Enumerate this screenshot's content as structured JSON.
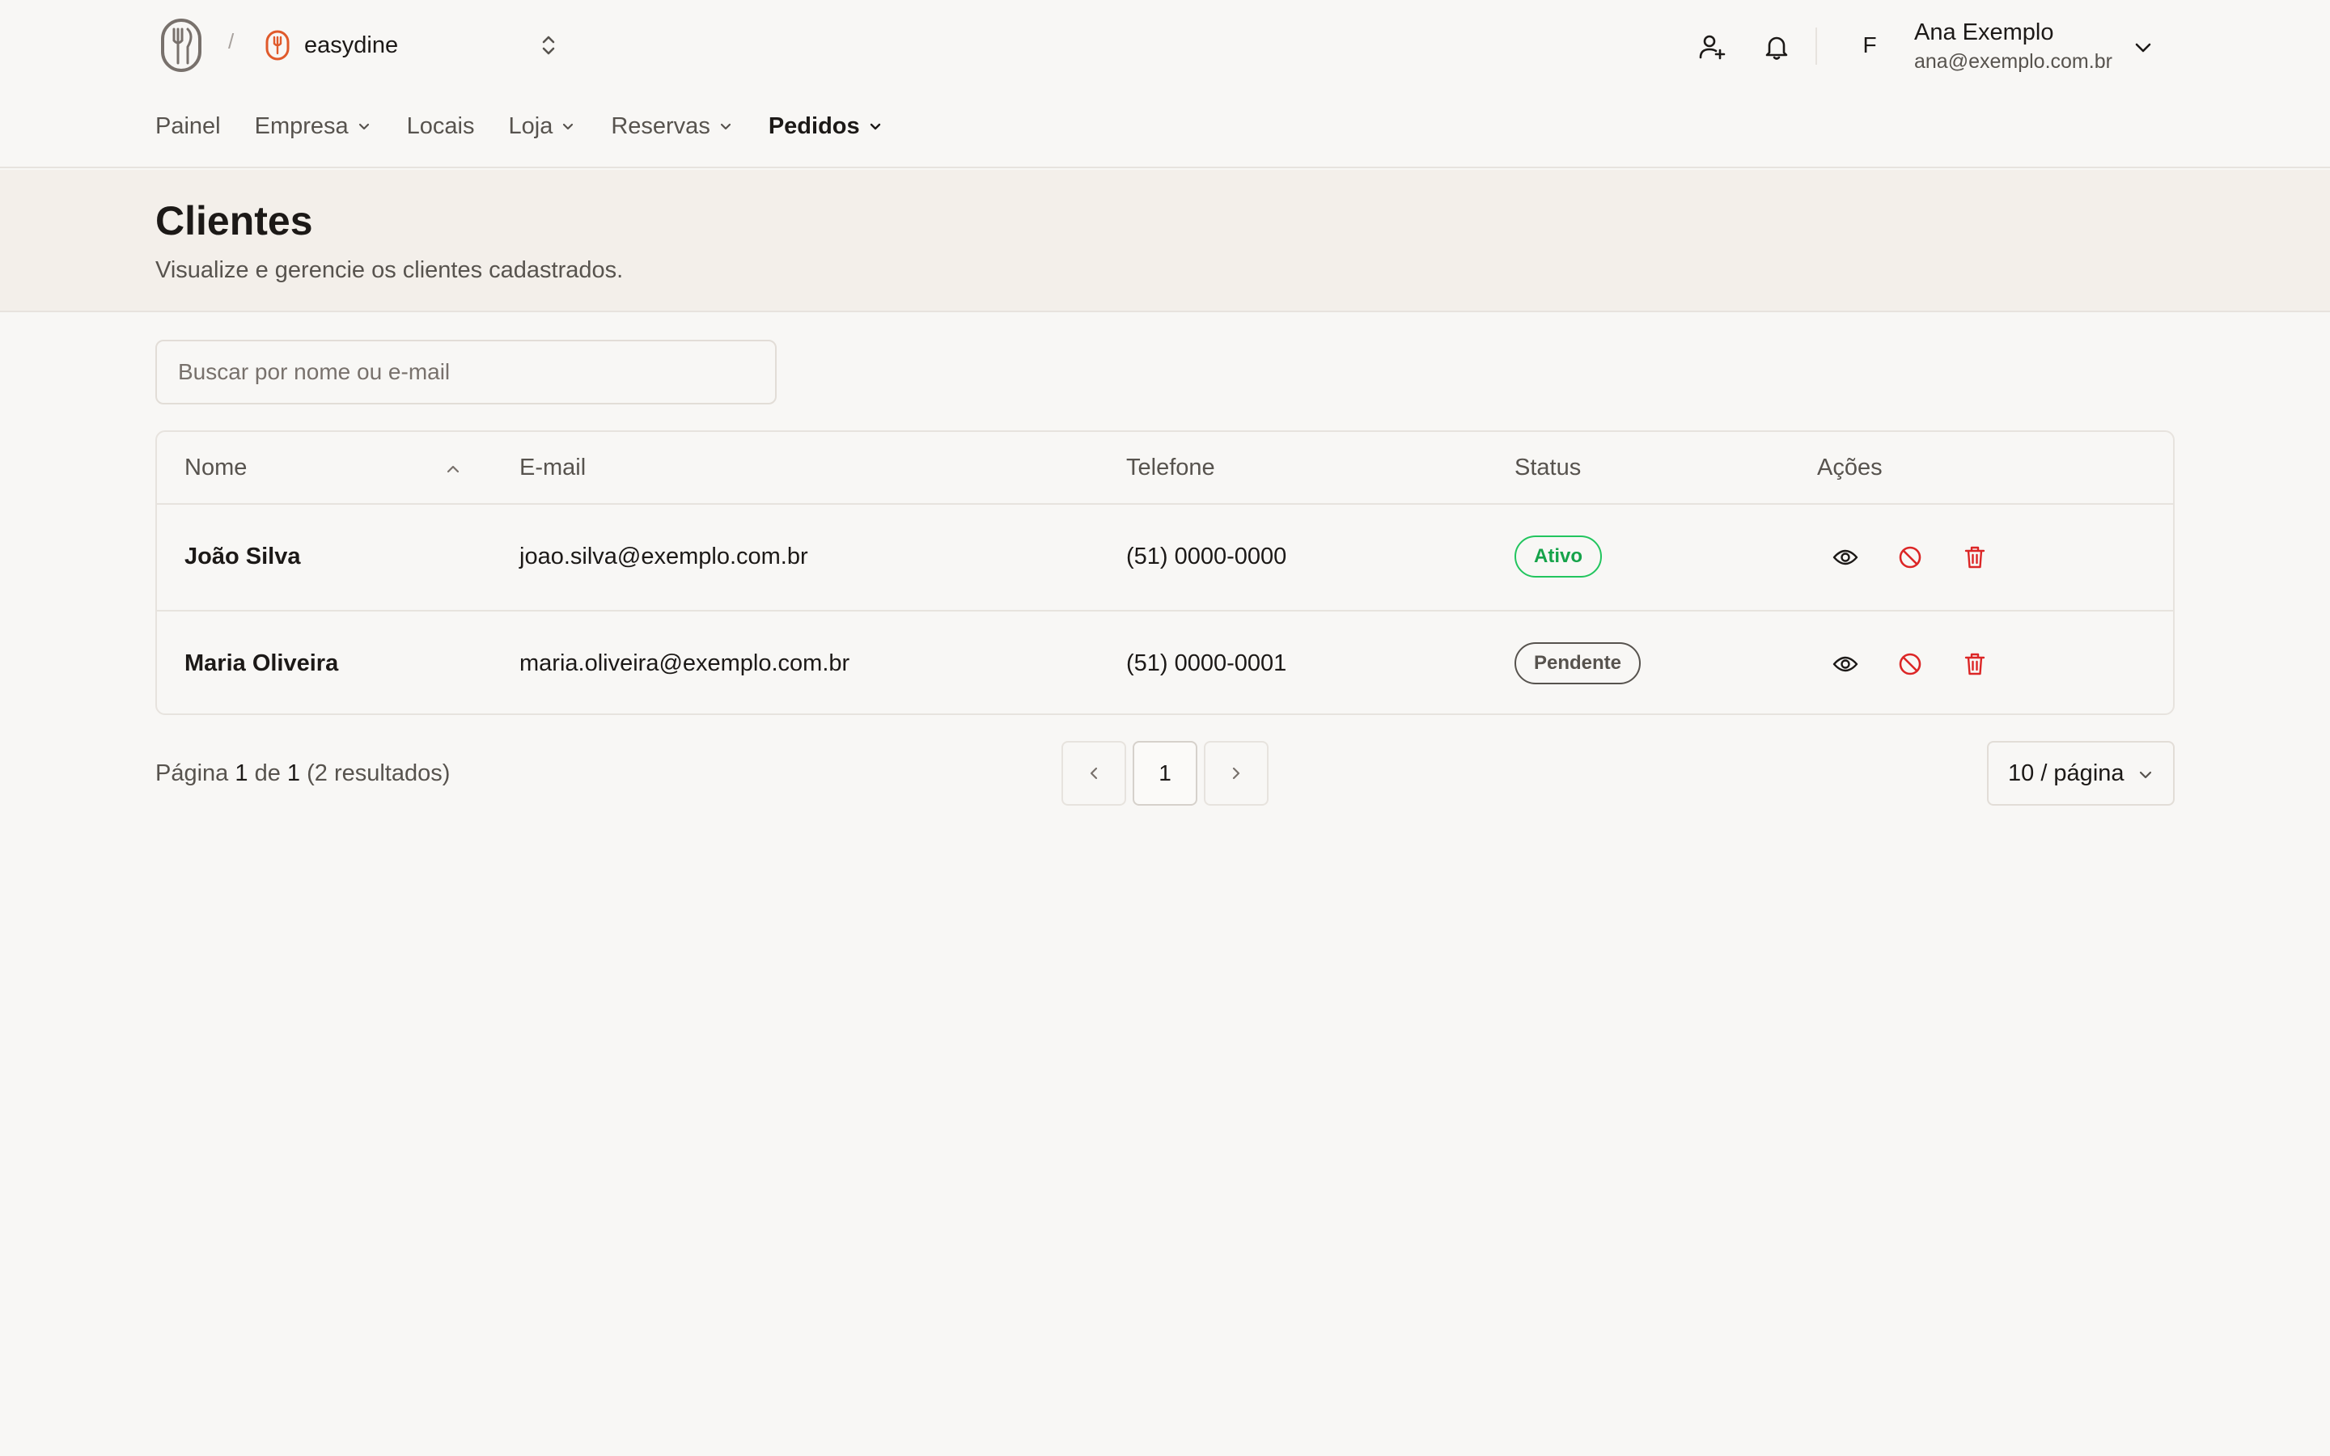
{
  "app": {
    "org_name": "easydine",
    "separator": "/",
    "colors": {
      "accent": "#e05a2b",
      "active_badge": "#16a34a",
      "danger": "#dc2626"
    }
  },
  "header": {
    "icons": [
      "fork-knife-logo-icon",
      "add-user-icon",
      "bell-icon",
      "chevron-down-icon"
    ],
    "user": {
      "initial": "F",
      "name": "Ana Exemplo",
      "email": "ana@exemplo.com.br"
    }
  },
  "nav": {
    "items": [
      {
        "label": "Painel"
      },
      {
        "label": "Empresa"
      },
      {
        "label": "Locais"
      },
      {
        "label": "Loja"
      },
      {
        "label": "Reservas"
      },
      {
        "label": "Pedidos"
      }
    ]
  },
  "page": {
    "title": "Clientes",
    "subtitle": "Visualize e gerencie os clientes cadastrados."
  },
  "search": {
    "placeholder": "Buscar por nome ou e-mail",
    "value": ""
  },
  "table": {
    "columns": [
      "Nome",
      "E-mail",
      "Telefone",
      "Status",
      "Ações"
    ],
    "rows": [
      {
        "name": "João Silva",
        "email": "joao.silva@exemplo.com.br",
        "phone": "(51) 0000-0000",
        "status": "Ativo"
      },
      {
        "name": "Maria Oliveira",
        "email": "maria.oliveira@exemplo.com.br",
        "phone": "(51) 0000-0001",
        "status": "Pendente"
      }
    ]
  },
  "pagination": {
    "label_page": "Página",
    "current": "1",
    "label_of": "de",
    "total_pages": "1",
    "results": "(2 resultados)",
    "page_button": "1",
    "per_page": "10 / página"
  }
}
